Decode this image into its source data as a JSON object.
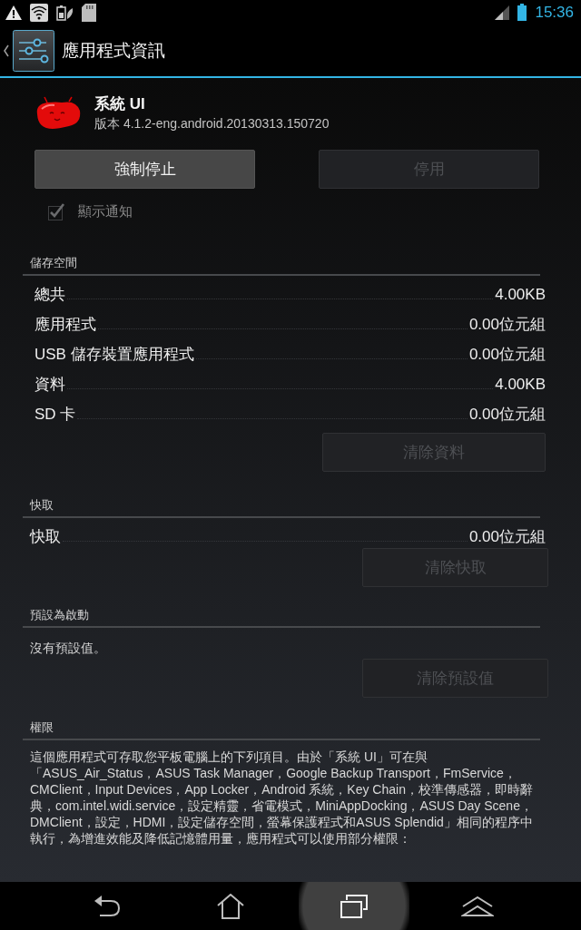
{
  "status_bar": {
    "time": "15:36"
  },
  "action_bar": {
    "title": "應用程式資訊"
  },
  "app": {
    "name": "系統 UI",
    "version": "版本 4.1.2-eng.android.20130313.150720"
  },
  "actions": [
    {
      "label": "強制停止",
      "disabled": false
    },
    {
      "label": "停用",
      "disabled": true
    }
  ],
  "show_notifications": {
    "label": "顯示通知",
    "checked": true,
    "disabled": true
  },
  "storage": {
    "title": "儲存空間",
    "rows": [
      {
        "label": "總共",
        "value": "4.00KB"
      },
      {
        "label": "應用程式",
        "value": "0.00位元組"
      },
      {
        "label": "USB 儲存裝置應用程式",
        "value": "0.00位元組"
      },
      {
        "label": "資料",
        "value": "4.00KB"
      },
      {
        "label": "SD 卡",
        "value": "0.00位元組"
      }
    ],
    "button": {
      "label": "清除資料",
      "disabled": true
    }
  },
  "cache": {
    "title": "快取",
    "rows": [
      {
        "label": "快取",
        "value": "0.00位元組"
      }
    ],
    "button": {
      "label": "清除快取",
      "disabled": true
    }
  },
  "launch_by_default": {
    "title": "預設為啟動",
    "text": "沒有預設值。",
    "button": {
      "label": "清除預設值",
      "disabled": true
    }
  },
  "permissions": {
    "title": "權限",
    "text": "這個應用程式可存取您平板電腦上的下列項目。由於「系統 UI」可在與「ASUS_Air_Status，ASUS Task Manager，Google Backup Transport，FmService，CMClient，Input Devices，App Locker，Android 系統，Key Chain，校準傳感器，即時辭典，com.intel.widi.service，設定精靈，省電模式，MiniAppDocking，ASUS Day Scene，DMClient，設定，HDMI，設定儲存空間，螢幕保護程式和ASUS Splendid」相同的程序中執行，為增進效能及降低記憶體用量，應用程式可以使用部分權限："
  },
  "nav_bar": {
    "buttons": [
      {
        "kind": "back",
        "pressed": false
      },
      {
        "kind": "home",
        "pressed": false
      },
      {
        "kind": "recents",
        "pressed": true
      },
      {
        "kind": "chevrons",
        "pressed": false
      }
    ]
  }
}
